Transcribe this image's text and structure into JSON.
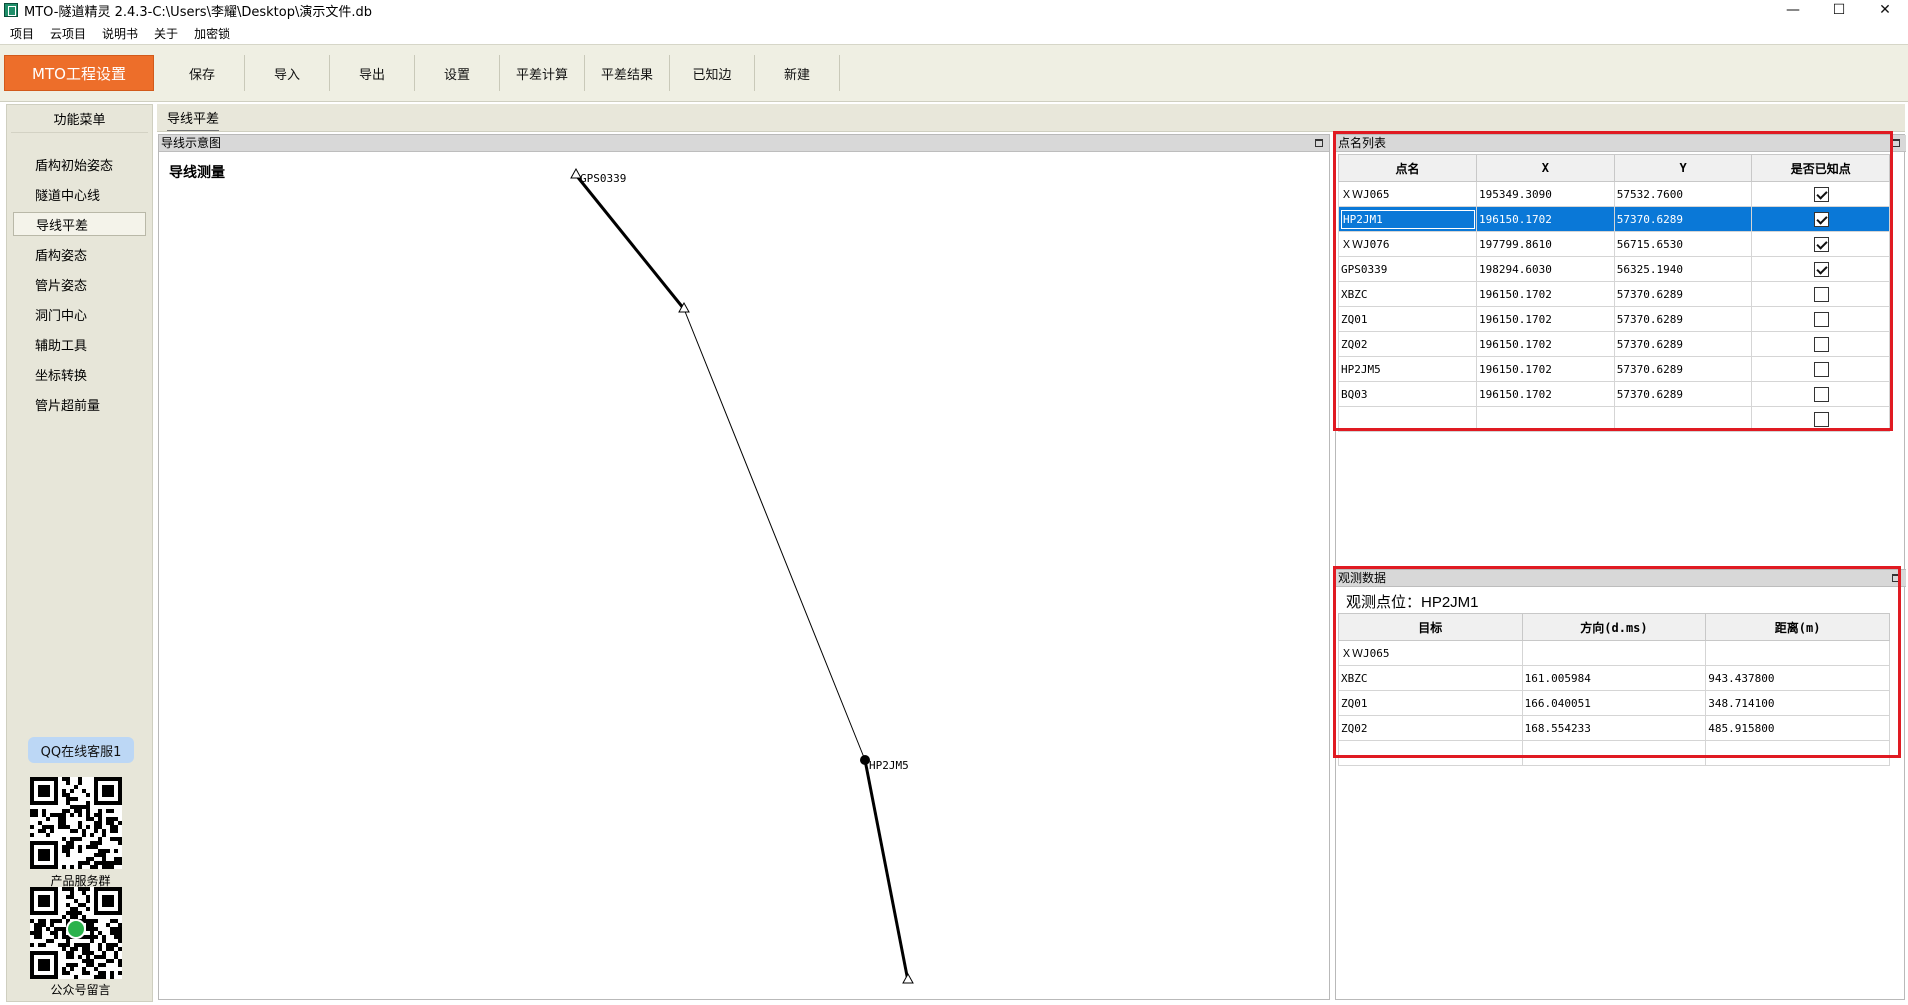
{
  "window": {
    "title": "MTO-隧道精灵 2.4.3-C:\\Users\\李耀\\Desktop\\演示文件.db",
    "minimize": "—",
    "maximize": "☐",
    "close": "✕"
  },
  "menu": [
    "项目",
    "云项目",
    "说明书",
    "关于",
    "加密锁"
  ],
  "toolbar": {
    "main_label": "MTO工程设置",
    "buttons": [
      "保存",
      "导入",
      "导出",
      "设置",
      "平差计算",
      "平差结果",
      "已知边",
      "新建"
    ]
  },
  "sidebar": {
    "title": "功能菜单",
    "items": [
      "盾构初始姿态",
      "隧道中心线",
      "导线平差",
      "盾构姿态",
      "管片姿态",
      "洞门中心",
      "辅助工具",
      "坐标转换",
      "管片超前量"
    ],
    "active_index": 2,
    "qq_label": "QQ在线客服1",
    "qr1_label": "产品服务群",
    "qr2_label": "公众号留言"
  },
  "main_tab": "导线平差",
  "canvas": {
    "header": "导线示意图",
    "title": "导线测量",
    "labels": {
      "gps": "GPS0339",
      "overlap": "HP2JM5"
    }
  },
  "points": {
    "header": "点名列表",
    "columns": [
      "点名",
      "X",
      "Y",
      "是否已知点"
    ],
    "rows": [
      {
        "name": "ＸＷJ065",
        "x": "195349.3090",
        "y": "57532.7600",
        "known": true
      },
      {
        "name": "HP2JM1",
        "x": "196150.1702",
        "y": "57370.6289",
        "known": true
      },
      {
        "name": "ＸＷJ076",
        "x": "197799.8610",
        "y": "56715.6530",
        "known": true
      },
      {
        "name": "GPS0339",
        "x": "198294.6030",
        "y": "56325.1940",
        "known": true
      },
      {
        "name": "XBZC",
        "x": "196150.1702",
        "y": "57370.6289",
        "known": false
      },
      {
        "name": "ZQ01",
        "x": "196150.1702",
        "y": "57370.6289",
        "known": false
      },
      {
        "name": "ZQ02",
        "x": "196150.1702",
        "y": "57370.6289",
        "known": false
      },
      {
        "name": "HP2JM5",
        "x": "196150.1702",
        "y": "57370.6289",
        "known": false
      },
      {
        "name": "BQ03",
        "x": "196150.1702",
        "y": "57370.6289",
        "known": false
      },
      {
        "name": "",
        "x": "",
        "y": "",
        "known": false
      }
    ],
    "selected_index": 1
  },
  "observations": {
    "header": "观测数据",
    "station_label": "观测点位：HP2JM1",
    "columns": [
      "目标",
      "方向(d.ms)",
      "距离(m)"
    ],
    "rows": [
      {
        "target": "ＸＷJ065",
        "direction": "",
        "distance": ""
      },
      {
        "target": "XBZC",
        "direction": "161.005984",
        "distance": "943.437800"
      },
      {
        "target": "ZQ01",
        "direction": "166.040051",
        "distance": "348.714100"
      },
      {
        "target": "ZQ02",
        "direction": "168.554233",
        "distance": "485.915800"
      },
      {
        "target": "",
        "direction": "",
        "distance": ""
      }
    ]
  },
  "colors": {
    "accent_orange": "#ed6e2a",
    "highlight_red": "#e01a22",
    "selection_blue": "#0a78d7",
    "qq_blue": "#bcd7f5"
  }
}
